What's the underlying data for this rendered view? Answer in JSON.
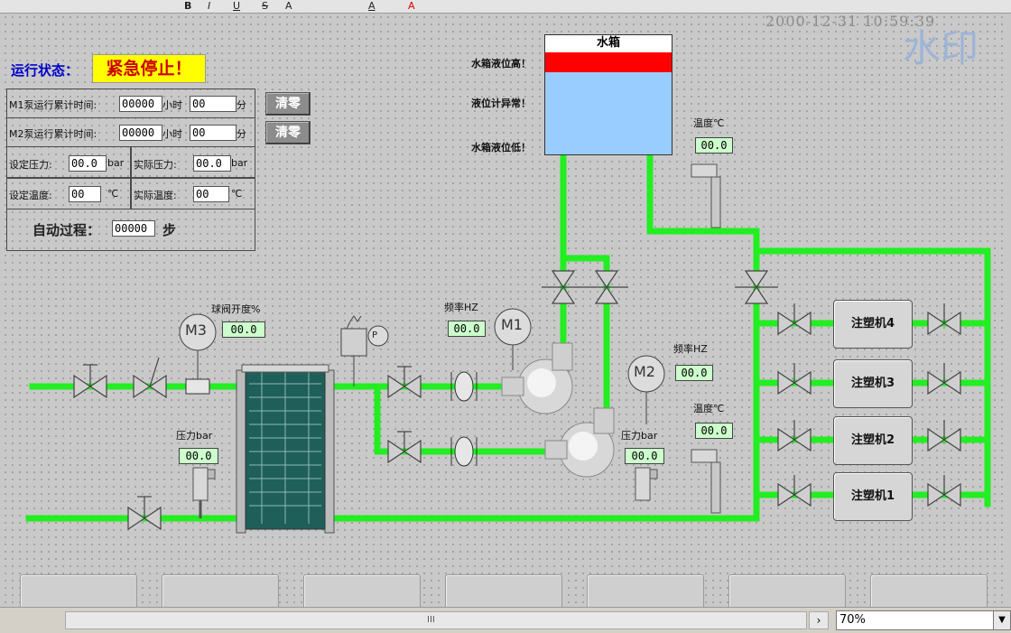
{
  "toolbar": {
    "items": [
      "B",
      "I",
      "U",
      "S",
      "A",
      "A",
      "A"
    ]
  },
  "clock": "2000-12-31 10:59:39",
  "watermark": "水印",
  "status": {
    "label": "运行状态：",
    "value": "紧急停止！"
  },
  "panel": {
    "m1_label": "M1泵运行累计时间:",
    "m1_hours": "00000",
    "m1_hours_unit": "小时",
    "m1_minutes": "00",
    "m1_minutes_unit": "分",
    "m2_label": "M2泵运行累计时间:",
    "m2_hours": "00000",
    "m2_hours_unit": "小时",
    "m2_minutes": "00",
    "m2_minutes_unit": "分",
    "set_pressure_label": "设定压力:",
    "set_pressure": "00.0",
    "pressure_unit": "bar",
    "actual_pressure_label": "实际压力:",
    "actual_pressure": "00.0",
    "set_temp_label": "设定温度:",
    "set_temp": "00",
    "temp_unit": "℃",
    "actual_temp_label": "实际温度:",
    "actual_temp": "00",
    "auto_label": "自动过程：",
    "auto_step": "00000",
    "auto_unit": "步",
    "clear_m1": "清零",
    "clear_m2": "清零"
  },
  "tank": {
    "title": "水箱",
    "high": "水箱液位高！",
    "fault": "液位计异常！",
    "low": "水箱液位低！",
    "high_color": "#ff0000",
    "water_color": "#99ccff"
  },
  "instruments": {
    "ball_valve_label": "球阀开度%",
    "ball_valve_value": "00.0",
    "pressure_in_label": "压力bar",
    "pressure_in_value": "00.0",
    "freq1_label": "频率HZ",
    "freq1_value": "00.0",
    "freq2_label": "频率HZ",
    "freq2_value": "00.0",
    "temp1_label": "温度℃",
    "temp1_value": "00.0",
    "temp2_label": "温度℃",
    "temp2_value": "00.0",
    "pressure_out_label": "压力bar",
    "pressure_out_value": "00.0"
  },
  "motors": {
    "m1": "M1",
    "m2": "M2",
    "m3": "M3",
    "p": "P"
  },
  "machines": [
    "注塑机4",
    "注塑机3",
    "注塑机2",
    "注塑机1"
  ],
  "statusbar": {
    "zoom": "70%",
    "scroll_glyph": "III"
  },
  "colors": {
    "pipe": "#22ee22",
    "status_bg": "#ffff00",
    "status_text": "#cc0000",
    "label_blue": "#0000cc"
  }
}
